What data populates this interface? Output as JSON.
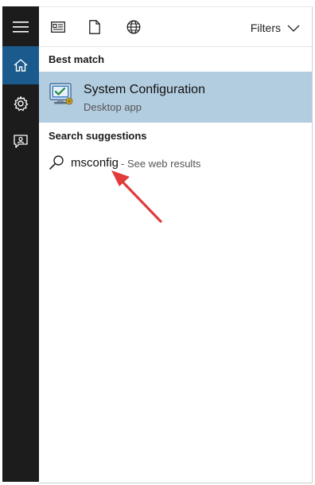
{
  "rail": {
    "items": [
      {
        "icon": "hamburger-menu-icon"
      },
      {
        "icon": "home-icon",
        "active": true
      },
      {
        "icon": "gear-icon"
      },
      {
        "icon": "feedback-icon"
      }
    ],
    "active_color": "#1a5a8c",
    "background": "#1c1c1c"
  },
  "toolbar": {
    "icons": [
      "apps-icon",
      "document-icon",
      "globe-icon"
    ],
    "filters_label": "Filters"
  },
  "best_match": {
    "title": "Best match",
    "item": {
      "name": "System Configuration",
      "subtitle": "Desktop app",
      "icon": "system-configuration-icon",
      "highlight_color": "#b3cde0"
    }
  },
  "suggestions": {
    "title": "Search suggestions",
    "items": [
      {
        "query": "msconfig",
        "extra": "- See web results",
        "icon": "search-icon"
      }
    ]
  },
  "annotation": {
    "arrow_color": "#e03c3c"
  }
}
